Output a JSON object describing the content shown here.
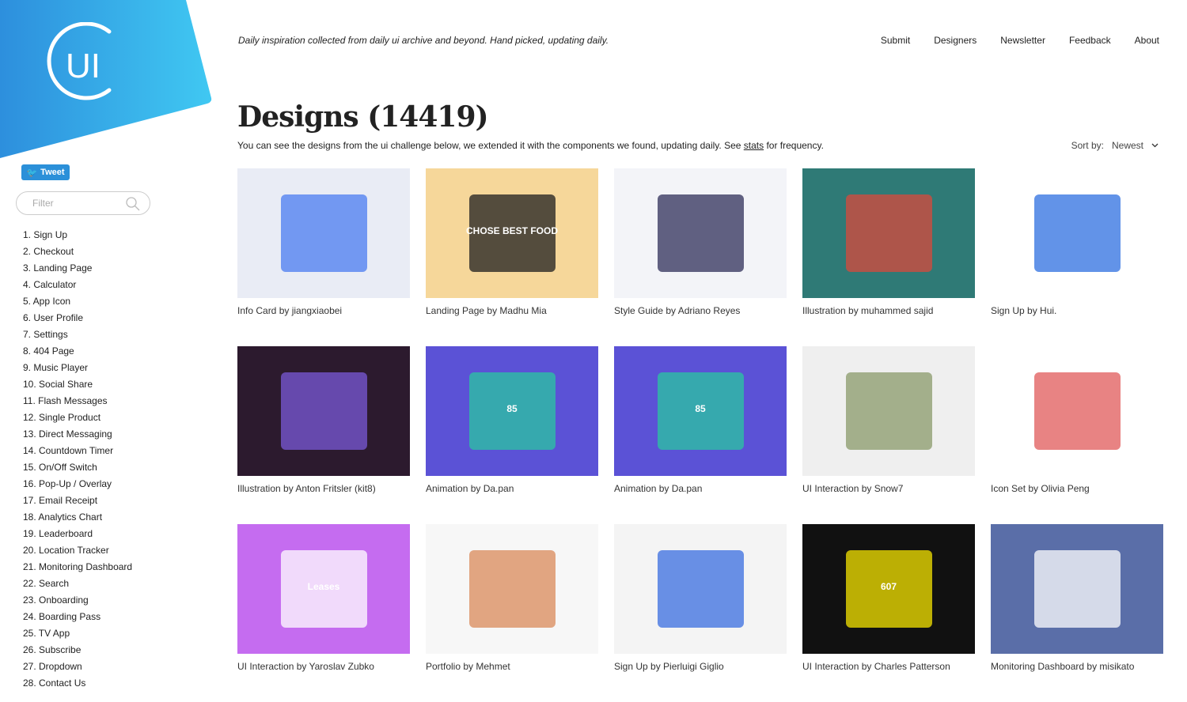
{
  "logo": {
    "text": "UI",
    "colors": [
      "#2d8fdd",
      "#40c8f2"
    ]
  },
  "tweet_label": "Tweet",
  "filter_placeholder": "Filter",
  "categories": [
    "1. Sign Up",
    "2. Checkout",
    "3. Landing Page",
    "4. Calculator",
    "5. App Icon",
    "6. User Profile",
    "7. Settings",
    "8. 404 Page",
    "9. Music Player",
    "10. Social Share",
    "11. Flash Messages",
    "12. Single Product",
    "13. Direct Messaging",
    "14. Countdown Timer",
    "15. On/Off Switch",
    "16. Pop-Up / Overlay",
    "17. Email Receipt",
    "18. Analytics Chart",
    "19. Leaderboard",
    "20. Location Tracker",
    "21. Monitoring Dashboard",
    "22. Search",
    "23. Onboarding",
    "24. Boarding Pass",
    "25. TV App",
    "26. Subscribe",
    "27. Dropdown",
    "28. Contact Us"
  ],
  "tagline": "Daily inspiration collected from daily ui archive and beyond. Hand picked, updating daily.",
  "nav": [
    "Submit",
    "Designers",
    "Newsletter",
    "Feedback",
    "About"
  ],
  "title": "Designs (14419)",
  "intro": {
    "before": "You can see the designs from the ui challenge below, we extended it with the components we found, updating daily. See ",
    "link": "stats",
    "after": " for frequency."
  },
  "sort": {
    "label": "Sort by:",
    "value": "Newest"
  },
  "designs": [
    {
      "caption": "Info Card by jiangxiaobei",
      "bg": "#e9ecf5",
      "accent": "#4a7cf0"
    },
    {
      "caption": "Landing Page by Madhu Mia",
      "bg": "#f6d79a",
      "accent": "#1d1d1d",
      "thumb_text": "CHOSE BEST FOOD"
    },
    {
      "caption": "Style Guide by Adriano Reyes",
      "bg": "#f3f4f8",
      "accent": "#2f2f5a"
    },
    {
      "caption": "Illustration by muhammed sajid",
      "bg": "#2f7a76",
      "accent": "#d94a3c"
    },
    {
      "caption": "Sign Up by Hui.",
      "bg": "#ffffff",
      "accent": "#2d6fe0"
    },
    {
      "caption": "Illustration by Anton Fritsler (kit8)",
      "bg": "#2c1a2e",
      "accent": "#7a5ad8"
    },
    {
      "caption": "Animation by Da.pan",
      "bg": "#5b52d6",
      "accent": "#2ac7a0",
      "thumb_text": "85"
    },
    {
      "caption": "Animation by Da.pan",
      "bg": "#5b52d6",
      "accent": "#2ac7a0",
      "thumb_text": "85"
    },
    {
      "caption": "UI Interaction by Snow7",
      "bg": "#efefef",
      "accent": "#8a9a6a"
    },
    {
      "caption": "Icon Set by Olivia Peng",
      "bg": "#ffffff",
      "accent": "#e05a5a"
    },
    {
      "caption": "UI Interaction by Yaroslav Zubko",
      "bg": "#c56cf0",
      "accent": "#ffffff",
      "thumb_text": "Leases"
    },
    {
      "caption": "Portfolio by Mehmet",
      "bg": "#f7f7f7",
      "accent": "#d98a5a"
    },
    {
      "caption": "Sign Up by Pierluigi Giglio",
      "bg": "#f4f4f4",
      "accent": "#3a6ee0"
    },
    {
      "caption": "UI Interaction by Charles Patterson",
      "bg": "#111111",
      "accent": "#f6e400",
      "thumb_text": "607"
    },
    {
      "caption": "Monitoring Dashboard by misikato",
      "bg": "#5a6ea8",
      "accent": "#ffffff"
    }
  ]
}
